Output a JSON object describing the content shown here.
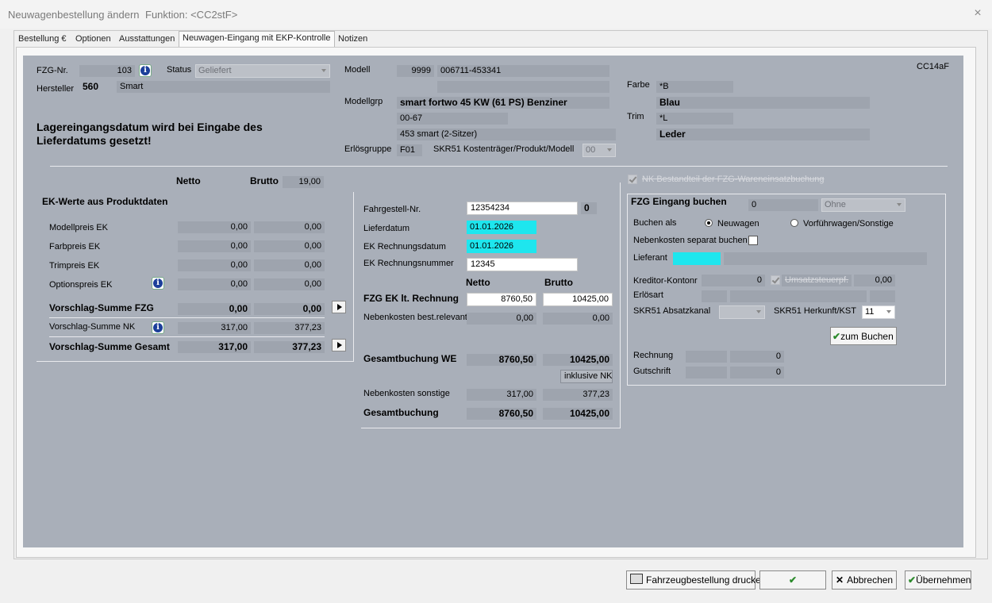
{
  "window": {
    "title": "Neuwagenbestellung ändern",
    "function": "Funktion: <CC2stF>",
    "close": "×"
  },
  "tabs": [
    "Bestellung €",
    "Optionen",
    "Ausstattungen",
    "Neuwagen-Eingang mit EKP-Kontrolle",
    "Notizen"
  ],
  "header": {
    "code": "CC14aF",
    "fzg_label": "FZG-Nr.",
    "fzg_value": "103",
    "status_label": "Status",
    "status_value": "Geliefert",
    "hersteller_label": "Hersteller",
    "hersteller_code": "560",
    "hersteller_name": "Smart",
    "modell_label": "Modell",
    "modell_code": "9999",
    "modell_nr": "006711-453341",
    "modellgrp_label": "Modellgrp",
    "modellgrp_value": "smart fortwo 45 KW (61 PS) Benziner",
    "modellgrp_line2": "00-67",
    "modellgrp_line3": "453 smart (2-Sitzer)",
    "erloesgruppe_label": "Erlösgruppe",
    "erloesgruppe_value": "F01",
    "skr51_label": "SKR51 Kostenträger/Produkt/Modell",
    "skr51_value": "00",
    "farbe_label": "Farbe",
    "farbe_code": "*B",
    "farbe_name": "Blau",
    "trim_label": "Trim",
    "trim_code": "*L",
    "trim_name": "Leder",
    "notice": "Lagereingangsdatum wird bei Eingabe des Lieferdatums gesetzt!"
  },
  "ek": {
    "netto_label": "Netto",
    "brutto_label": "Brutto",
    "tax": "19,00",
    "section_title": "EK-Werte aus Produktdaten",
    "rows": [
      {
        "label": "Modellpreis EK",
        "netto": "0,00",
        "brutto": "0,00"
      },
      {
        "label": "Farbpreis EK",
        "netto": "0,00",
        "brutto": "0,00"
      },
      {
        "label": "Trimpreis EK",
        "netto": "0,00",
        "brutto": "0,00"
      },
      {
        "label": "Optionspreis EK",
        "netto": "0,00",
        "brutto": "0,00"
      }
    ],
    "sum_fzg_label": "Vorschlag-Summe FZG",
    "sum_fzg_netto": "0,00",
    "sum_fzg_brutto": "0,00",
    "sum_nk_label": "Vorschlag-Summe NK",
    "sum_nk_netto": "317,00",
    "sum_nk_brutto": "377,23",
    "sum_total_label": "Vorschlag-Summe Gesamt",
    "sum_total_netto": "317,00",
    "sum_total_brutto": "377,23"
  },
  "mid": {
    "fahrgestell_label": "Fahrgestell-Nr.",
    "fahrgestell_value": "12354234",
    "fahrgestell_extra": "0",
    "lieferdatum_label": "Lieferdatum",
    "lieferdatum_value": "01.01.2026",
    "ekrd_label": "EK Rechnungsdatum",
    "ekrd_value": "01.01.2026",
    "ekrn_label": "EK Rechnungsnummer",
    "ekrn_value": "12345",
    "netto_label": "Netto",
    "brutto_label": "Brutto",
    "fzg_ek_label": "FZG EK lt. Rechnung",
    "fzg_ek_netto": "8760,50",
    "fzg_ek_brutto": "10425,00",
    "nk_rel_label": "Nebenkosten best.relevant",
    "nk_rel_netto": "0,00",
    "nk_rel_brutto": "0,00",
    "ges_we_label": "Gesamtbuchung WE",
    "ges_we_netto": "8760,50",
    "ges_we_brutto": "10425,00",
    "inkl_nk": "inklusive NK",
    "nk_sonst_label": "Nebenkosten sonstige",
    "nk_sonst_netto": "317,00",
    "nk_sonst_brutto": "377,23",
    "ges_label": "Gesamtbuchung",
    "ges_netto": "8760,50",
    "ges_brutto": "10425,00"
  },
  "right": {
    "nk_check_label": "NK Bestandteil der FZG-Wareneinsatzbuchung",
    "title": "FZG Eingang buchen",
    "title_value": "0",
    "title_combo": "Ohne",
    "buchen_als_label": "Buchen als",
    "radio1": "Neuwagen",
    "radio2": "Vorführwagen/Sonstige",
    "nk_sep_label": "Nebenkosten separat buchen",
    "lieferant_label": "Lieferant",
    "kreditor_label": "Kreditor-Kontonr",
    "kreditor_value": "0",
    "ust_label": "Umsatzsteuerpf.",
    "ust_value": "0,00",
    "erloesart_label": "Erlösart",
    "absatz_label": "SKR51 Absatzkanal",
    "herkunft_label": "SKR51 Herkunft/KST",
    "herkunft_value": "11",
    "zum_buchen": "zum Buchen",
    "rechnung_label": "Rechnung",
    "rechnung_value": "0",
    "gutschrift_label": "Gutschrift",
    "gutschrift_value": "0"
  },
  "footer": {
    "print": "Fahrzeugbestellung drucken",
    "ok": "✔",
    "cancel": "Abbrechen",
    "apply": "Übernehmen"
  }
}
